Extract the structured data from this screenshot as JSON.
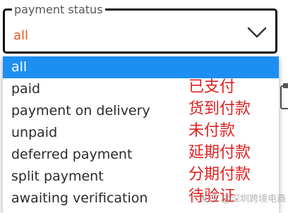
{
  "select": {
    "label": "payment status",
    "value": "all"
  },
  "options": [
    {
      "label": "all",
      "note": ""
    },
    {
      "label": "paid",
      "note": "已支付"
    },
    {
      "label": "payment on delivery",
      "note": "货到付款"
    },
    {
      "label": "unpaid",
      "note": "未付款"
    },
    {
      "label": "deferred payment",
      "note": "延期付款"
    },
    {
      "label": "split payment",
      "note": "分期付款"
    },
    {
      "label": "awaiting verification",
      "note": "待验证"
    }
  ],
  "watermark": "知乎 @深圳跨境电商",
  "colors": {
    "accent_value": "#e8541e",
    "selected_bg": "#1e8ff2",
    "note_red": "#e02020"
  }
}
